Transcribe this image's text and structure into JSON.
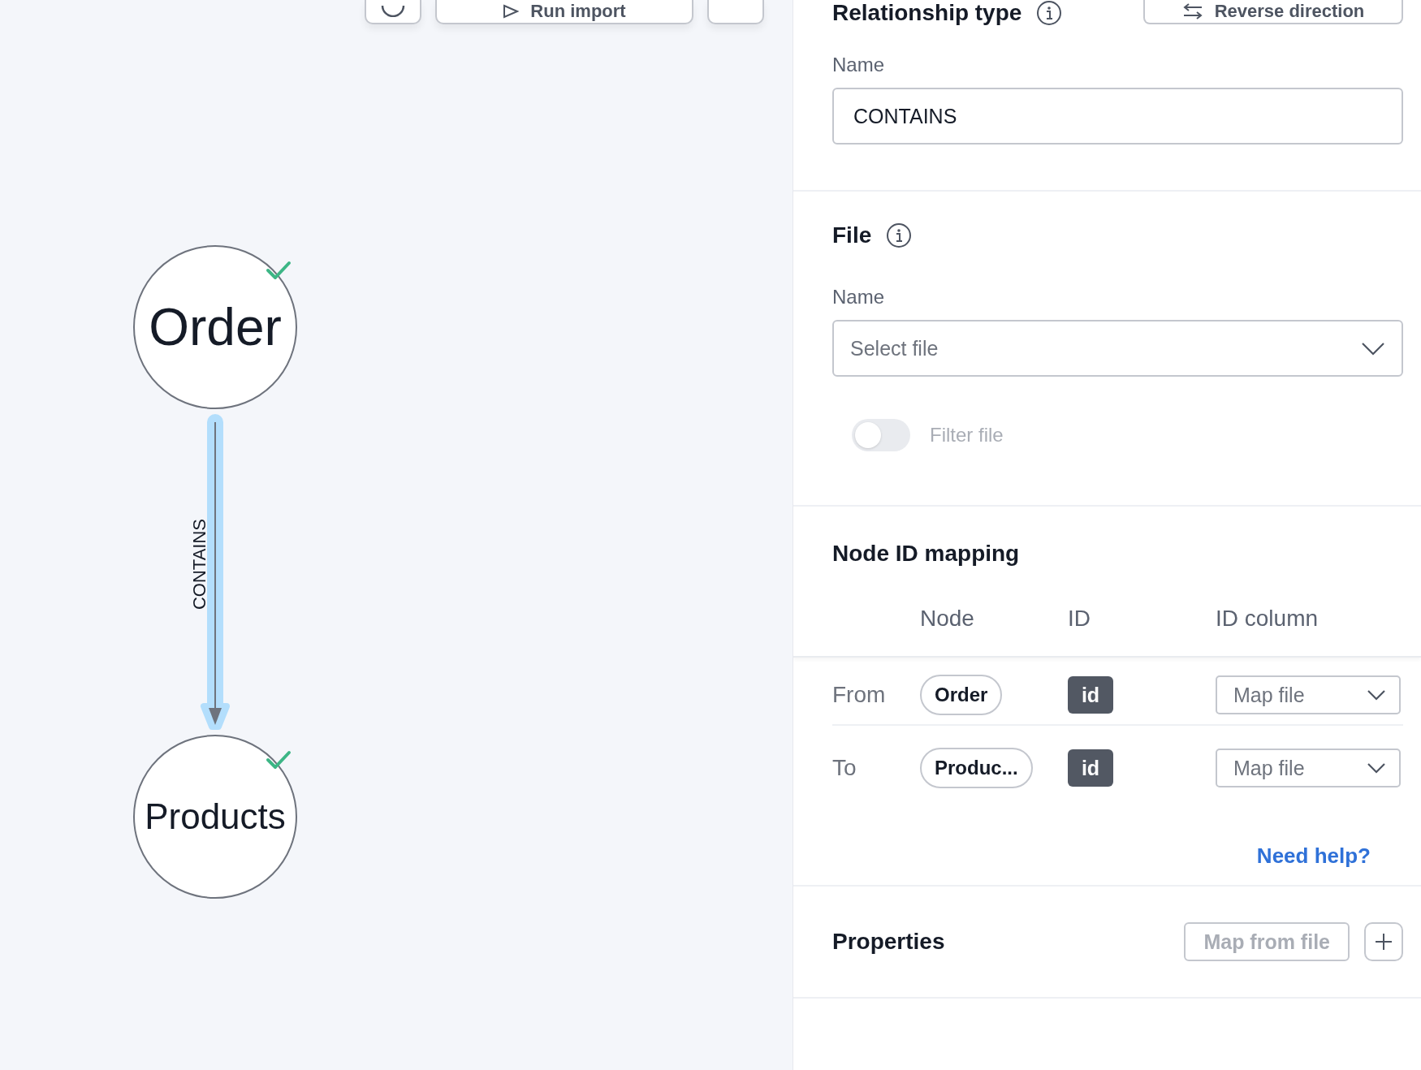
{
  "toolbar": {
    "buttons": [
      {
        "kind": "icon"
      },
      {
        "kind": "primary",
        "label": "Run import"
      },
      {
        "kind": "blank"
      }
    ]
  },
  "graph": {
    "nodes": [
      {
        "label": "Order",
        "mapped": true
      },
      {
        "label": "Products",
        "mapped": true
      }
    ],
    "edge": {
      "label": "CONTAINS",
      "selected": true
    }
  },
  "panel": {
    "relationship_type": {
      "title": "Relationship type",
      "reverse_button": "Reverse direction",
      "name_label": "Name",
      "name_value": "CONTAINS"
    },
    "file": {
      "title": "File",
      "name_label": "Name",
      "select_placeholder": "Select file",
      "filter": {
        "label": "Filter file",
        "on": false,
        "disabled": true
      }
    },
    "node_id_mapping": {
      "title": "Node ID mapping",
      "columns": [
        "Node",
        "ID",
        "ID column"
      ],
      "rows": [
        {
          "label": "From",
          "node": "Order",
          "id": "id",
          "column_placeholder": "Map file"
        },
        {
          "label": "To",
          "node": "Produc...",
          "id": "id",
          "column_placeholder": "Map file"
        }
      ],
      "help_link": "Need help?"
    },
    "properties": {
      "title": "Properties",
      "map_button": "Map from file",
      "map_disabled": true
    }
  }
}
